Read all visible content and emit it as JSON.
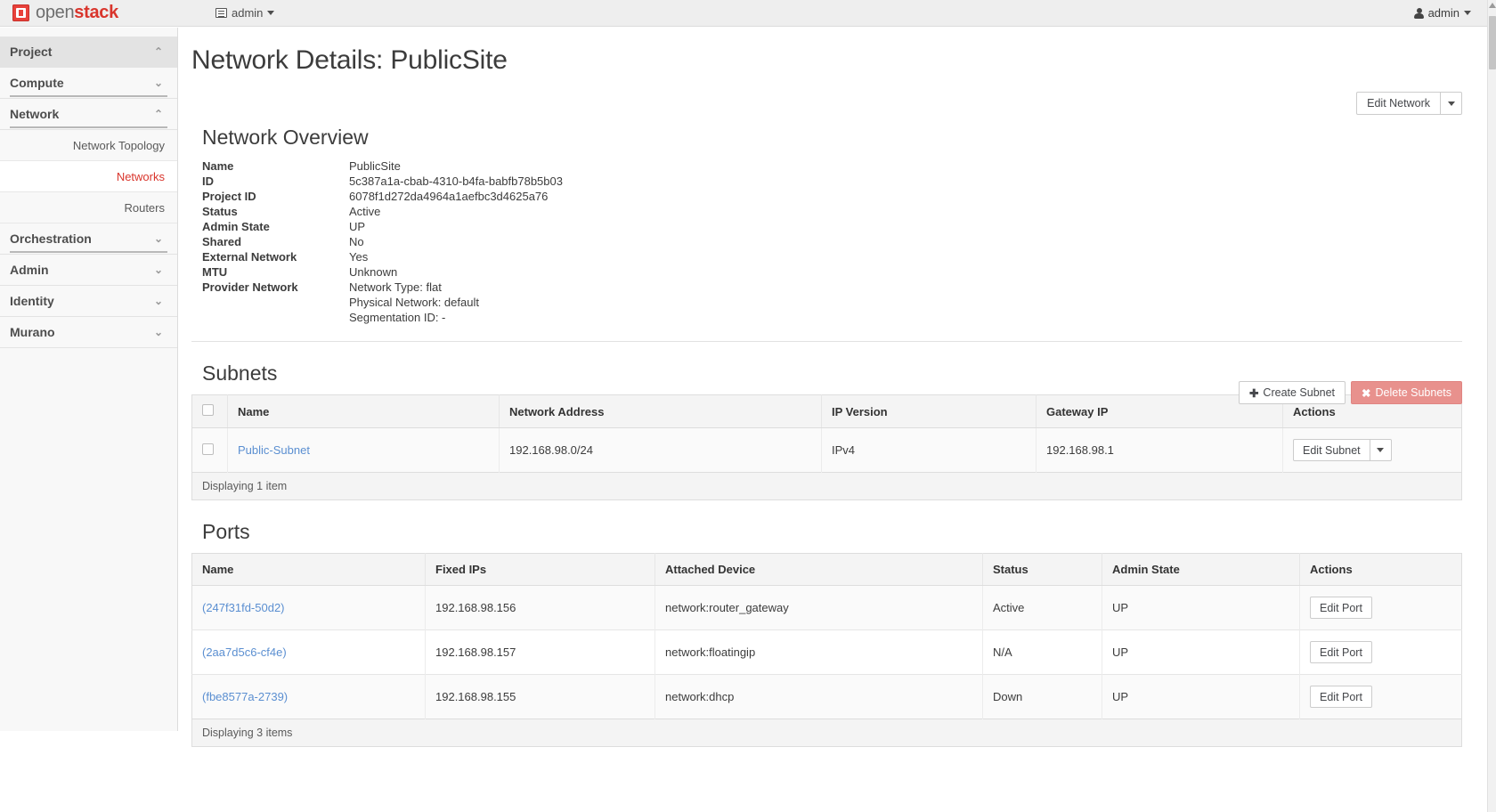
{
  "header": {
    "brand_open": "open",
    "brand_stack": "stack",
    "project_switch_label": "admin",
    "user_label": "admin"
  },
  "sidebar": {
    "project_header": "Project",
    "groups": [
      {
        "label": "Compute",
        "chevron": "down"
      },
      {
        "label": "Network",
        "chevron": "up"
      },
      {
        "label": "Orchestration",
        "chevron": "down"
      },
      {
        "label": "Admin",
        "chevron": "down"
      },
      {
        "label": "Identity",
        "chevron": "down"
      },
      {
        "label": "Murano",
        "chevron": "down"
      }
    ],
    "network_items": [
      {
        "label": "Network Topology",
        "active": false
      },
      {
        "label": "Networks",
        "active": true
      },
      {
        "label": "Routers",
        "active": false
      }
    ]
  },
  "page": {
    "title": "Network Details: PublicSite",
    "edit_network_label": "Edit Network"
  },
  "overview": {
    "heading": "Network Overview",
    "rows": [
      {
        "key": "Name",
        "value": "PublicSite"
      },
      {
        "key": "ID",
        "value": "5c387a1a-cbab-4310-b4fa-babfb78b5b03"
      },
      {
        "key": "Project ID",
        "value": "6078f1d272da4964a1aefbc3d4625a76"
      },
      {
        "key": "Status",
        "value": "Active"
      },
      {
        "key": "Admin State",
        "value": "UP"
      },
      {
        "key": "Shared",
        "value": "No"
      },
      {
        "key": "External Network",
        "value": "Yes"
      },
      {
        "key": "MTU",
        "value": "Unknown"
      },
      {
        "key": "Provider Network",
        "value": "Network Type: flat"
      },
      {
        "key": "",
        "value": "Physical Network: default"
      },
      {
        "key": "",
        "value": "Segmentation ID: -"
      }
    ]
  },
  "subnets": {
    "heading": "Subnets",
    "create_label": "Create Subnet",
    "delete_label": "Delete Subnets",
    "columns": [
      "Name",
      "Network Address",
      "IP Version",
      "Gateway IP",
      "Actions"
    ],
    "rows": [
      {
        "name": "Public-Subnet",
        "network_address": "192.168.98.0/24",
        "ip_version": "IPv4",
        "gateway_ip": "192.168.98.1",
        "action": "Edit Subnet"
      }
    ],
    "footer": "Displaying 1 item"
  },
  "ports": {
    "heading": "Ports",
    "columns": [
      "Name",
      "Fixed IPs",
      "Attached Device",
      "Status",
      "Admin State",
      "Actions"
    ],
    "rows": [
      {
        "name": "(247f31fd-50d2)",
        "fixed_ips": "192.168.98.156",
        "attached_device": "network:router_gateway",
        "status": "Active",
        "admin_state": "UP",
        "action": "Edit Port"
      },
      {
        "name": "(2aa7d5c6-cf4e)",
        "fixed_ips": "192.168.98.157",
        "attached_device": "network:floatingip",
        "status": "N/A",
        "admin_state": "UP",
        "action": "Edit Port"
      },
      {
        "name": "(fbe8577a-2739)",
        "fixed_ips": "192.168.98.155",
        "attached_device": "network:dhcp",
        "status": "Down",
        "admin_state": "UP",
        "action": "Edit Port"
      }
    ],
    "footer": "Displaying 3 items"
  },
  "colors": {
    "brand_red": "#d9352c",
    "link_blue": "#5b8fd1",
    "danger": "#e8918d"
  }
}
